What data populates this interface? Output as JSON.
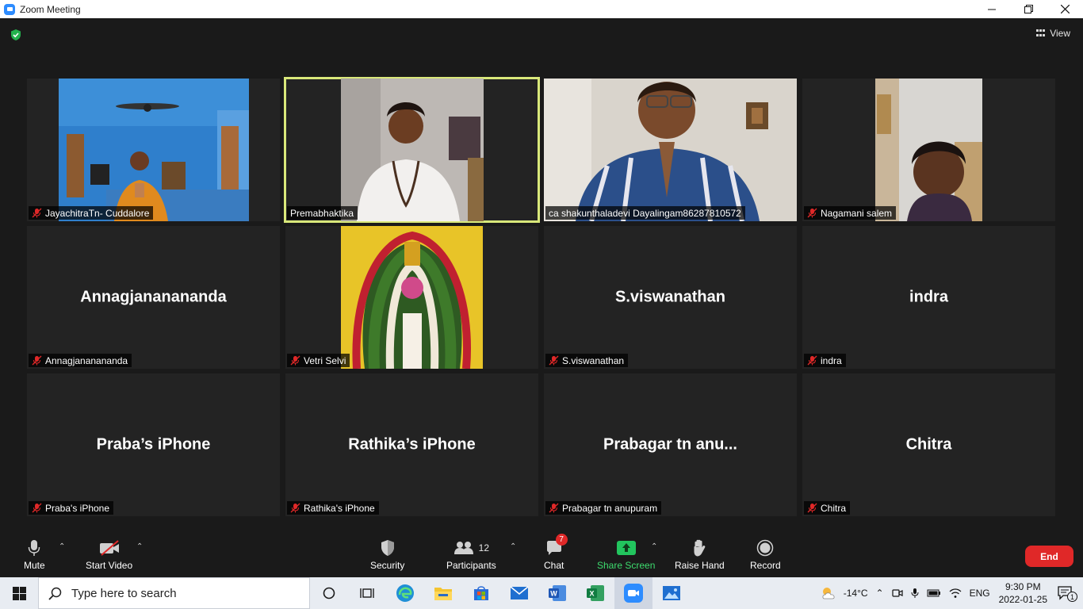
{
  "window": {
    "title": "Zoom Meeting"
  },
  "meeting": {
    "view_label": "View",
    "tiles": [
      {
        "name": "JayachitraTn- Cuddalore",
        "bigname": "",
        "has_video": true,
        "muted": true
      },
      {
        "name": "Premabhaktika",
        "bigname": "",
        "has_video": true,
        "muted": false,
        "active_speaker": true
      },
      {
        "name": "ca shakunthaladevi Dayalingam86287810572",
        "bigname": "",
        "has_video": true,
        "muted": false
      },
      {
        "name": "Nagamani salem",
        "bigname": "",
        "has_video": true,
        "muted": true
      },
      {
        "name": "Annagjananananda",
        "bigname": "Annagjananananda",
        "has_video": false,
        "muted": true
      },
      {
        "name": "Vetri Selvi",
        "bigname": "",
        "has_video": true,
        "muted": true
      },
      {
        "name": "S.viswanathan",
        "bigname": "S.viswanathan",
        "has_video": false,
        "muted": true
      },
      {
        "name": "indra",
        "bigname": "indra",
        "has_video": false,
        "muted": true
      },
      {
        "name": "Praba's iPhone",
        "bigname": "Praba’s iPhone",
        "has_video": false,
        "muted": true
      },
      {
        "name": "Rathika's iPhone",
        "bigname": "Rathika’s iPhone",
        "has_video": false,
        "muted": true
      },
      {
        "name": "Prabagar tn anupuram",
        "bigname": "Prabagar tn anu...",
        "has_video": false,
        "muted": true
      },
      {
        "name": "Chitra",
        "bigname": "Chitra",
        "has_video": false,
        "muted": true
      }
    ]
  },
  "toolbar": {
    "mute": "Mute",
    "start_video": "Start Video",
    "security": "Security",
    "participants": "Participants",
    "participants_count": "12",
    "chat": "Chat",
    "chat_badge": "7",
    "share_screen": "Share Screen",
    "raise_hand": "Raise Hand",
    "record": "Record",
    "end": "End",
    "share_color": "#22c55e",
    "end_color": "#e02828"
  },
  "taskbar": {
    "search_placeholder": "Type here to search",
    "weather": "-14°C",
    "language": "ENG",
    "time": "9:30 PM",
    "date": "2022-01-25",
    "notification_count": "1"
  }
}
